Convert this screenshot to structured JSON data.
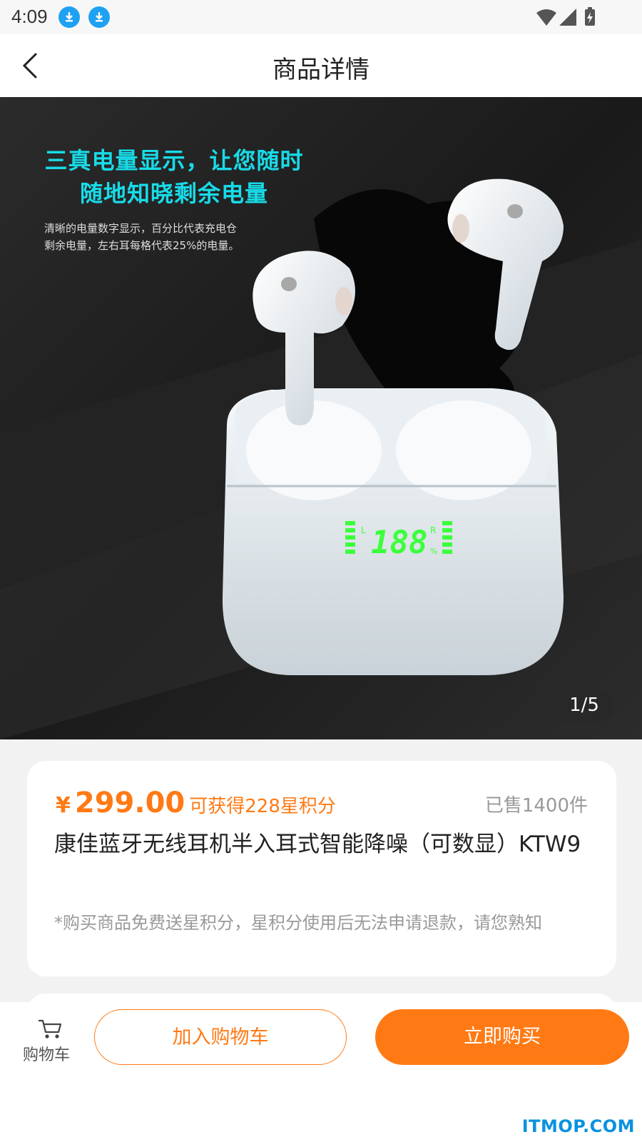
{
  "status_bar": {
    "time": "4:09"
  },
  "nav": {
    "title": "商品详情"
  },
  "hero": {
    "headline_line1": "三真电量显示，让您随时",
    "headline_line2": "随地知晓剩余电量",
    "sub_line1": "清晰的电量数字显示，百分比代表充电仓",
    "sub_line2": "剩余电量，左右耳每格代表25%的电量。",
    "display_digits": "188",
    "display_left": "L",
    "display_right": "R",
    "display_pct": "%",
    "counter": "1/5"
  },
  "product": {
    "currency": "¥",
    "price": "299.00",
    "points_text": "可获得228星积分",
    "sold": "已售1400件",
    "title": "康佳蓝牙无线耳机半入耳式智能降噪（可数显）KTW9",
    "note": "*购买商品免费送星积分，星积分使用后无法申请退款，请您熟知"
  },
  "bottom_bar": {
    "cart_label": "购物车",
    "add_to_cart": "加入购物车",
    "buy_now": "立即购买"
  },
  "watermark": "ITMOP.COM",
  "colors": {
    "accent": "#ff7a15",
    "headline": "#18dbe8",
    "display": "#3cff3c"
  }
}
